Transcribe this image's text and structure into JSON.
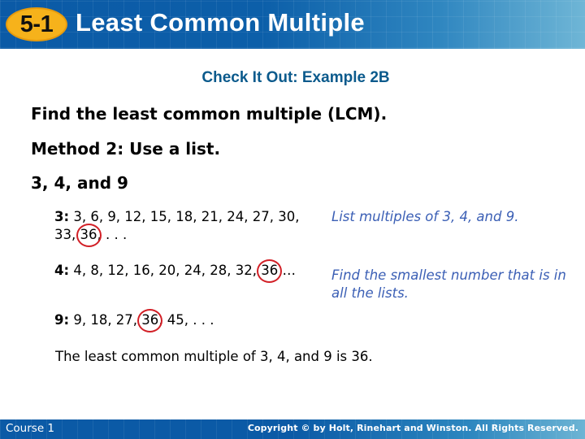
{
  "header": {
    "lesson_badge": "5-1",
    "title": "Least Common Multiple",
    "badge_color": "#f6b21b",
    "bar_color": "#0b5aa6"
  },
  "content": {
    "subtitle": "Check It Out: Example 2B",
    "prompt": "Find the least common multiple (LCM).",
    "method": "Method 2: Use a list.",
    "numbers": "3, 4, and 9",
    "lists": [
      {
        "label": "3:",
        "before": " 3, 6, 9, 12, 15, 18, 21, 24, 27, 30, 33, ",
        "circled": "36",
        "after": ", . . ."
      },
      {
        "label": "4:",
        "before": " 4, 8, 12, 16, 20, 24, 28, 32, ",
        "circled": "36",
        "after": " …"
      },
      {
        "label": "9:",
        "before": " 9, 18, 27, ",
        "circled": "36",
        "after": ", 45, . . ."
      }
    ],
    "notes": [
      "List multiples of 3, 4, and 9.",
      "Find the smallest number that is in all the lists."
    ],
    "conclusion": "The least common multiple of 3, 4, and 9 is 36.",
    "circle_color": "#d21f26",
    "note_color": "#3b5fb5"
  },
  "footer": {
    "course": "Course 1",
    "copyright": "Copyright © by Holt, Rinehart and Winston. All Rights Reserved."
  }
}
